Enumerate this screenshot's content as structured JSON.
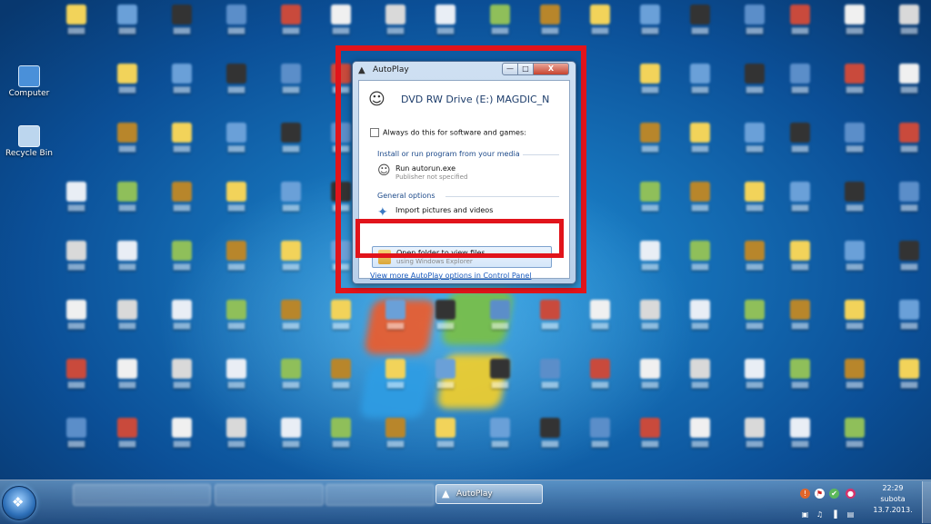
{
  "desktop": {
    "icons": [
      {
        "label": "Computer",
        "color": "#4a90d9"
      },
      {
        "label": "Recycle Bin",
        "color": "#bcd6ee"
      }
    ]
  },
  "dialog": {
    "title": "AutoPlay",
    "drive_title": "DVD RW Drive (E:) MAGDIC_N",
    "always_label": "Always do this for software and games:",
    "section_install": "Install or run program from your media",
    "run_title": "Run autorun.exe",
    "run_sub": "Publisher not specified",
    "section_general": "General options",
    "import_title": "Import pictures and videos",
    "open_title": "Open folder to view files",
    "open_sub": "using Windows Explorer",
    "more_link": "View more AutoPlay options in Control Panel",
    "min_glyph": "—",
    "max_glyph": "□",
    "close_glyph": "X"
  },
  "taskbar": {
    "autoplay_label": "AutoPlay",
    "clock_time": "22:29",
    "clock_day": "subota",
    "clock_date": "13.7.2013."
  },
  "colors": {
    "highlight_outline": "#e1141b"
  }
}
